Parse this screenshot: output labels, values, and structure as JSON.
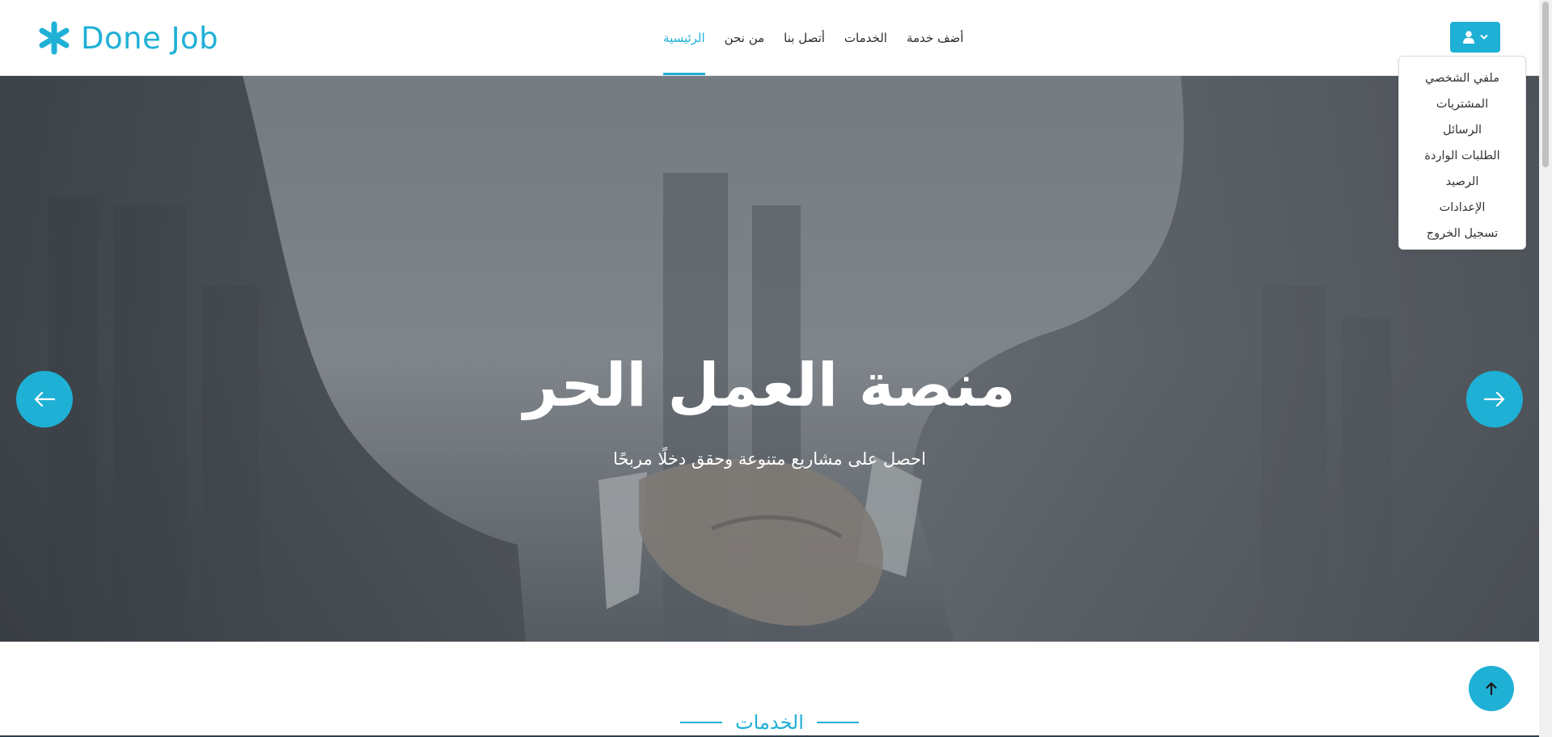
{
  "brand": {
    "name": "Done Job",
    "color": "#1fb0d6",
    "icon": "asterisk-icon"
  },
  "nav": {
    "items": [
      {
        "label": "الرئيسية",
        "active": true
      },
      {
        "label": "من نحن",
        "active": false
      },
      {
        "label": "أتصل بنا",
        "active": false
      },
      {
        "label": "الخدمات",
        "active": false
      },
      {
        "label": "أضف خدمة",
        "active": false
      }
    ]
  },
  "user_menu": {
    "button_icon": "user-icon",
    "chevron_icon": "chevron-down-icon",
    "items": [
      "ملفي الشخصي",
      "المشتريات",
      "الرسائل",
      "الطلبات الواردة",
      "الرصيد",
      "الإعدادات",
      "تسجيل الخروج"
    ]
  },
  "hero": {
    "title": "منصة العمل الحر",
    "subtitle": "احصل على مشاريع متنوعة وحقق دخلًا مربحًا",
    "prev_icon": "arrow-left-icon",
    "next_icon": "arrow-right-icon"
  },
  "section": {
    "title": "الخدمات"
  },
  "scroll_top": {
    "icon": "arrow-up-icon"
  }
}
